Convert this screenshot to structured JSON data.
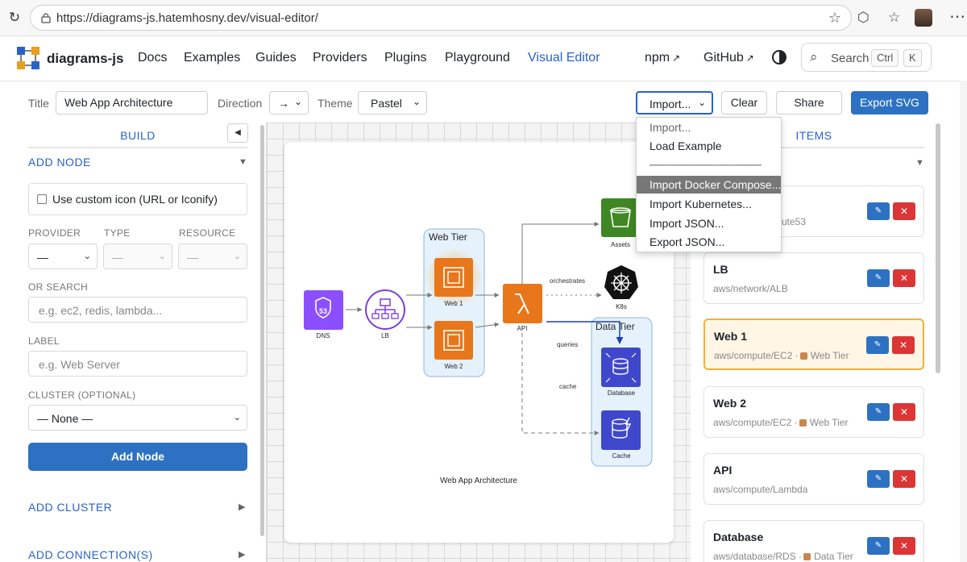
{
  "browser": {
    "url": "https://diagrams-js.hatemhosny.dev/visual-editor/"
  },
  "header": {
    "brand": "diagrams-js",
    "nav": [
      {
        "label": "Docs"
      },
      {
        "label": "Examples"
      },
      {
        "label": "Guides"
      },
      {
        "label": "Providers"
      },
      {
        "label": "Plugins"
      },
      {
        "label": "Playground"
      },
      {
        "label": "Visual Editor"
      }
    ],
    "npm": "npm",
    "github": "GitHub",
    "search_placeholder": "Search",
    "kbd_ctrl": "Ctrl",
    "kbd_k": "K"
  },
  "toolbar": {
    "title_label": "Title",
    "title_value": "Web App Architecture",
    "direction_label": "Direction",
    "direction_value": "→",
    "theme_label": "Theme",
    "theme_value": "Pastel",
    "import_value": "Import...",
    "clear": "Clear",
    "share": "Share",
    "export_svg": "Export SVG"
  },
  "import_menu": {
    "items": [
      "Import...",
      "Load Example",
      "──────────────",
      "Import Docker Compose...",
      "Import Kubernetes...",
      "Import JSON...",
      "Export JSON..."
    ]
  },
  "left": {
    "tab": "BUILD",
    "add_node": "ADD NODE",
    "custom_icon": "Use custom icon (URL or Iconify)",
    "provider_label": "PROVIDER",
    "provider_value": "—",
    "type_label": "TYPE",
    "type_value": "—",
    "resource_label": "RESOURCE",
    "resource_value": "—",
    "search_label": "OR SEARCH",
    "search_placeholder": "e.g. ec2, redis, lambda...",
    "label_label": "LABEL",
    "label_placeholder": "e.g. Web Server",
    "cluster_label": "CLUSTER (OPTIONAL)",
    "cluster_value": "— None —",
    "add_node_button": "Add Node",
    "add_cluster": "ADD CLUSTER",
    "add_connections": "ADD CONNECTION(S)"
  },
  "diagram": {
    "title": "Web App Architecture",
    "clusters": [
      "Web Tier",
      "Data Tier"
    ],
    "nodes": [
      "DNS",
      "LB",
      "Web 1",
      "Web 2",
      "API",
      "Assets",
      "K8s",
      "Database",
      "Cache"
    ],
    "edge_labels": [
      "orchestrates",
      "queries",
      "cache"
    ]
  },
  "right": {
    "tab": "ITEMS",
    "items": [
      {
        "name": "",
        "path": "ute53",
        "cluster": ""
      },
      {
        "name": "LB",
        "path": "aws/network/ALB",
        "cluster": ""
      },
      {
        "name": "Web 1",
        "path": "aws/compute/EC2 ·",
        "cluster": "Web Tier"
      },
      {
        "name": "Web 2",
        "path": "aws/compute/EC2 ·",
        "cluster": "Web Tier"
      },
      {
        "name": "API",
        "path": "aws/compute/Lambda",
        "cluster": ""
      },
      {
        "name": "Database",
        "path": "aws/database/RDS ·",
        "cluster": "Data Tier"
      }
    ]
  },
  "colors": {
    "accent": "#2a62c9",
    "primary_button": "#2d72c2",
    "delete": "#dc3535",
    "selected_border": "#f0b13a",
    "aws_orange": "#e8761a",
    "aws_purple": "#7c3ed6"
  }
}
